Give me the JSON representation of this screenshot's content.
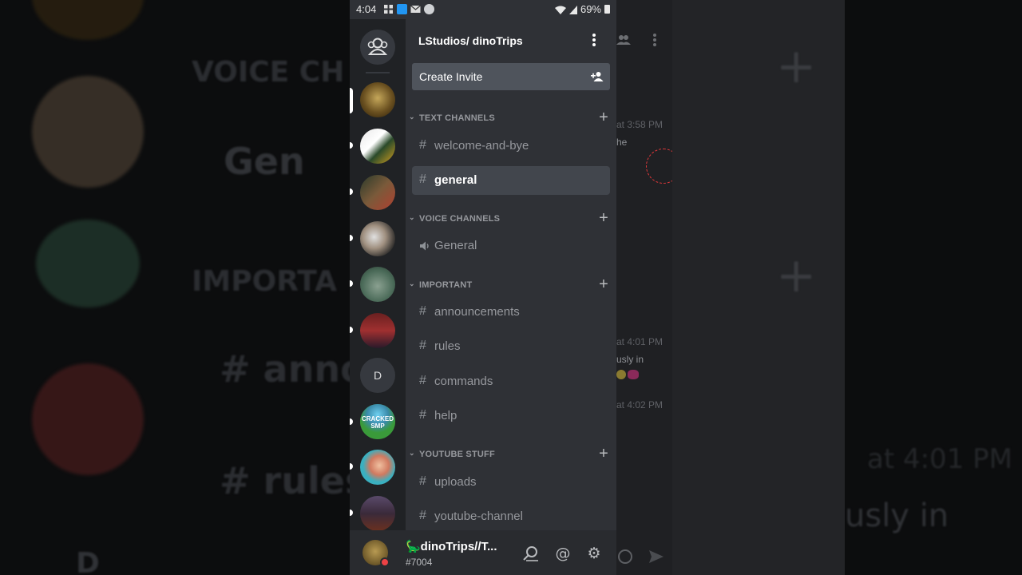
{
  "status_bar": {
    "time": "4:04",
    "battery": "69%"
  },
  "server": {
    "name": "LStudios/ dinoTrips",
    "invite_label": "Create Invite"
  },
  "categories": [
    {
      "label": "TEXT CHANNELS"
    },
    {
      "label": "VOICE CHANNELS"
    },
    {
      "label": "IMPORTANT"
    },
    {
      "label": "YOUTUBE STUFF"
    }
  ],
  "channels": {
    "welcome": "welcome-and-bye",
    "general_text": "general",
    "general_voice": "General",
    "announcements": "announcements",
    "rules": "rules",
    "commands": "commands",
    "help": "help",
    "uploads": "uploads",
    "youtube_channel": "youtube-channel"
  },
  "guilds": {
    "letter_server": "D",
    "cracked_smp": "CRACKED SMP"
  },
  "user": {
    "name": "🦕dinoTrips//T...",
    "tag": "#7004"
  },
  "behind": {
    "t1": "at 3:58 PM",
    "t2": "he",
    "t3": "at 4:01 PM",
    "t4": "usly in",
    "t5": "at 4:02 PM"
  },
  "backdrop": {
    "voice": "VOICE CH",
    "gen": "Gen",
    "important": "IMPORTA",
    "anno": "# anno",
    "rules": "# rules",
    "time": "at 4:01 PM",
    "usly": "usly in",
    "d": "D"
  },
  "colors": {
    "bg": "#2f3136",
    "rail": "#202225",
    "active": "#42464d",
    "muted": "#96989d",
    "dnd": "#ed4245"
  }
}
